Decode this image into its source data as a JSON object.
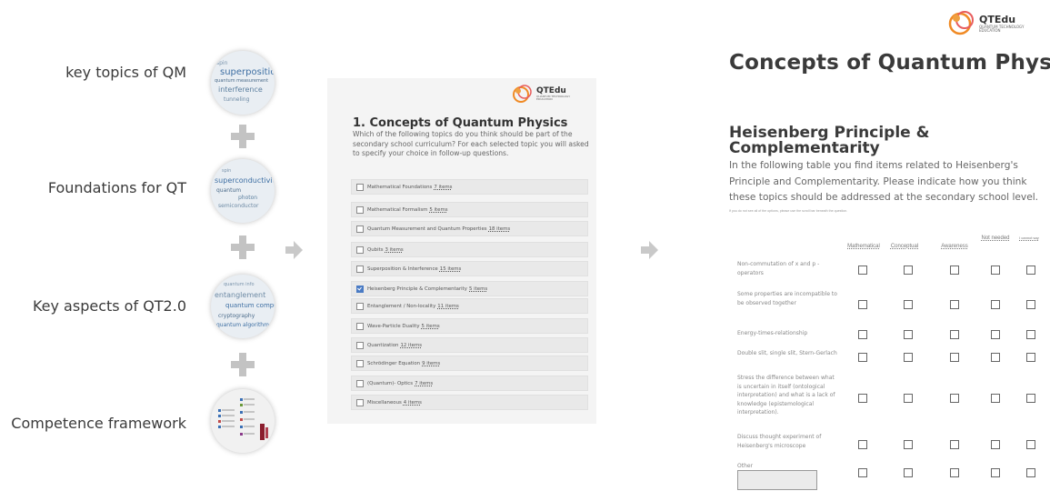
{
  "left_labels": [
    "key topics of QM",
    "Foundations for QT",
    "Key aspects of QT2.0",
    "Competence framework"
  ],
  "circles": {
    "c1": [
      "superposition",
      "quantum measurement",
      "interference",
      "tunneling",
      "spin"
    ],
    "c2": [
      "superconductivity",
      "quantum",
      "photon",
      "semiconductor",
      "spin"
    ],
    "c3": [
      "quantum info",
      "entanglement",
      "quantum computing",
      "quantum algorithm",
      "cryptography"
    ]
  },
  "logo": {
    "text": "QTEdu",
    "sub": "Quantum Technology Education"
  },
  "middle": {
    "title": "1. Concepts of Quantum Physics",
    "description": "Which of the following topics do you think should be part of the secondary school curriculum? For each selected topic you will asked to specify your choice in follow-up questions.",
    "topics": [
      {
        "label": "Mathematical Foundations",
        "items": "7 items",
        "checked": false
      },
      {
        "label": "Mathematical Formalism",
        "items": "5 items",
        "checked": false
      },
      {
        "label": "Quantum Measurement and Quantum Properties",
        "items": "18 items",
        "checked": false
      },
      {
        "label": "Qubits",
        "items": "3 items",
        "checked": false
      },
      {
        "label": "Superposition & Interference",
        "items": "15 items",
        "checked": false
      },
      {
        "label": "Heisenberg Principle & Complementarity",
        "items": "5 items",
        "checked": true
      },
      {
        "label": "Entanglement / Non-locality",
        "items": "11 items",
        "checked": false
      },
      {
        "label": "Wave-Particle Duality",
        "items": "5 items",
        "checked": false
      },
      {
        "label": "Quantization",
        "items": "12 items",
        "checked": false
      },
      {
        "label": "Schrödinger Equation",
        "items": "9 items",
        "checked": false
      },
      {
        "label": "(Quantum)- Optics",
        "items": "7 items",
        "checked": false
      },
      {
        "label": "Miscellaneous",
        "items": "4 items",
        "checked": false
      }
    ]
  },
  "right": {
    "title": "Concepts of Quantum Physics",
    "subtitle": "Heisenberg Principle & Complementarity",
    "description": "In the following table you find items related to Heisenberg's Principle and Complementarity. Please indicate how you think these topics should be addressed at the secondary school level.",
    "note": "If you do not see all of the options, please use the scroll bar beneath the question.",
    "columns": [
      "Mathematical",
      "Conceptual",
      "Awareness",
      "Not needed",
      "I cannot say"
    ],
    "rows": [
      "Non-commutation of x and p - operators",
      "Some properties are incompatible to be observed together",
      "Energy-times-relationship",
      "Double slit, single slit, Stern-Gerlach",
      "Stress the difference between what is uncertain in itself (ontological interpretation) and what is a lack of knowledge (epistemological interpretation).",
      "Discuss thought experiment of Heisenberg's microscope",
      "Other"
    ]
  },
  "colors": {
    "accent_orange": "#f08a24",
    "check_blue": "#4a7bc4",
    "plus_gray": "#c3c3c3"
  }
}
